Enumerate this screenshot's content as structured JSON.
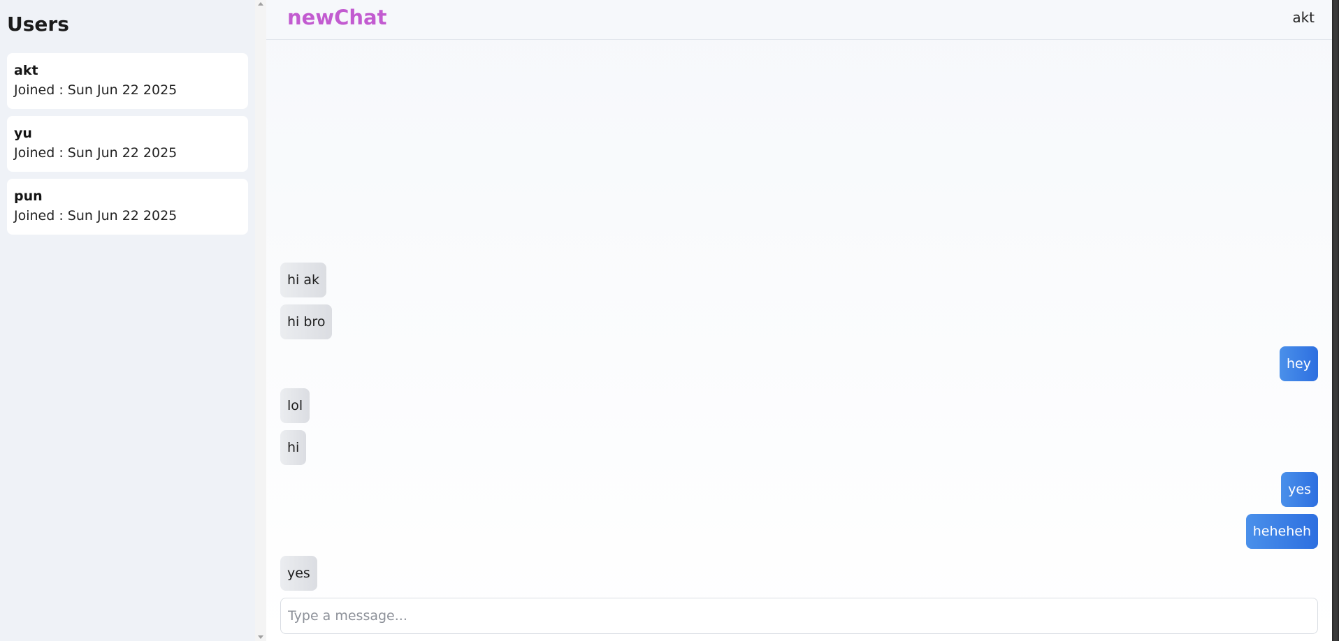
{
  "sidebar": {
    "title": "Users",
    "users": [
      {
        "name": "akt",
        "joined": "Joined : Sun Jun 22 2025"
      },
      {
        "name": "yu",
        "joined": "Joined : Sun Jun 22 2025"
      },
      {
        "name": "pun",
        "joined": "Joined : Sun Jun 22 2025"
      }
    ]
  },
  "header": {
    "brand": "newChat",
    "current_user": "akt"
  },
  "messages": [
    {
      "text": "hi ak",
      "direction": "incoming"
    },
    {
      "text": "hi bro",
      "direction": "incoming"
    },
    {
      "text": "hey",
      "direction": "outgoing"
    },
    {
      "text": "lol",
      "direction": "incoming"
    },
    {
      "text": "hi",
      "direction": "incoming"
    },
    {
      "text": "yes",
      "direction": "outgoing"
    },
    {
      "text": "heheheh",
      "direction": "outgoing"
    },
    {
      "text": "yes",
      "direction": "incoming"
    }
  ],
  "composer": {
    "placeholder": "Type a message...",
    "value": ""
  },
  "colors": {
    "brand": "#c25bd0",
    "outgoing_bubble": "#3b7fe6",
    "incoming_bubble": "#e3e5e9",
    "sidebar_bg": "#eff2f7"
  }
}
